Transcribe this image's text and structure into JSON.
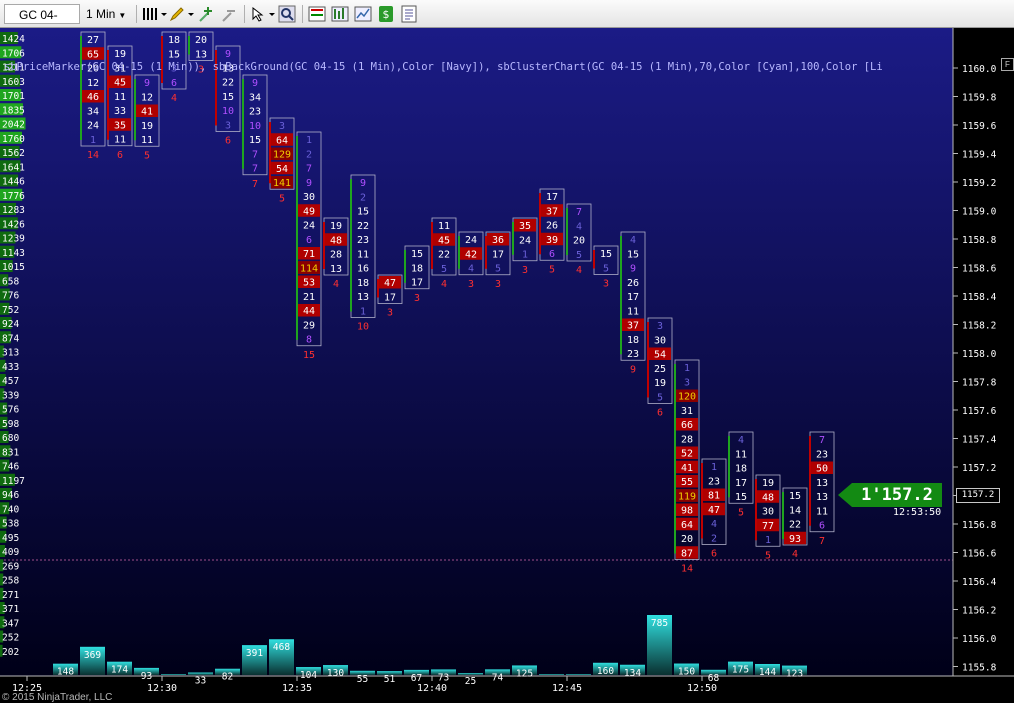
{
  "toolbar": {
    "instrument": "GC 04-15",
    "interval": "1 Min",
    "icons": [
      "bar-type-icon",
      "drawing-pencil-icon",
      "zoom-in-icon",
      "zoom-out-icon",
      "cursor-icon",
      "magnifier-icon",
      "chart-trader-icon",
      "indicators-icon",
      "strategies-icon",
      "order-icon",
      "properties-icon"
    ]
  },
  "chart": {
    "indicators_label": "sbPriceMarker(GC 04-15 (1 Min)), sbBackGround(GC 04-15 (1 Min),Color [Navy]), sbClusterChart(GC 04-15 (1 Min),70,Color [Cyan],100,Color [Li",
    "corner_button": "F",
    "last_price": "1'157.2",
    "axis_price_tag": "1157.2",
    "clock": "12:53:50",
    "copyright": "© 2015 NinjaTrader, LLC",
    "colors": {
      "background_top": "#1a1a7a",
      "background_bottom": "#000020",
      "ask_red": "#b00000",
      "bid_green": "#138a13",
      "volume_cyan": "#20d0d0",
      "text": "#ffffff",
      "purple_text": "#b050ff"
    },
    "price_axis": [
      "1160.0",
      "1159.8",
      "1159.6",
      "1159.4",
      "1159.2",
      "1159.0",
      "1158.8",
      "1158.6",
      "1158.4",
      "1158.2",
      "1158.0",
      "1157.8",
      "1157.6",
      "1157.4",
      "1157.2",
      "1157.0",
      "1156.8",
      "1156.6",
      "1156.4",
      "1156.2",
      "1156.0",
      "1155.8"
    ],
    "time_axis": [
      "12:25",
      "12:30",
      "12:35",
      "12:40",
      "12:45",
      "12:50"
    ],
    "left_volume_profile": [
      "1424",
      "1706",
      "1211",
      "1603",
      "1701",
      "1835",
      "2042",
      "1760",
      "1562",
      "1641",
      "1446",
      "1776",
      "1283",
      "1426",
      "1239",
      "1143",
      "1015",
      "658",
      "776",
      "752",
      "924",
      "874",
      "313",
      "433",
      "457",
      "339",
      "576",
      "598",
      "680",
      "831",
      "746",
      "1197",
      "946",
      "740",
      "538",
      "495",
      "409",
      "269",
      "258",
      "271",
      "371",
      "347",
      "252",
      "202"
    ],
    "columns": [
      {
        "top": [
          "27",
          "65",
          "20",
          "12",
          "46",
          "34",
          "24",
          "1"
        ],
        "bottom": "14"
      },
      {
        "top": [
          "19",
          "31",
          "45",
          "11",
          "33",
          "35",
          "11"
        ],
        "bottom": "6"
      },
      {
        "top": [
          "9",
          "12",
          "41",
          "19",
          "11"
        ],
        "bottom": "5"
      },
      {
        "top": [
          "18",
          "15",
          "3",
          "6"
        ],
        "bottom": "4"
      },
      {
        "top": [
          "20",
          "13"
        ],
        "bottom": "3"
      },
      {
        "top": [
          "9",
          "13",
          "22",
          "15",
          "10",
          "3"
        ],
        "bottom": "6"
      },
      {
        "top": [
          "9",
          "34",
          "23",
          "10",
          "15",
          "7",
          "7"
        ],
        "bottom": "7"
      },
      {
        "top": [
          "3",
          "64",
          "129",
          "54",
          "141"
        ],
        "bottom": "5"
      },
      {
        "top": [
          "1",
          "2",
          "7",
          "9",
          "30",
          "49",
          "24",
          "6",
          "71",
          "114",
          "53",
          "21",
          "44",
          "29",
          "8"
        ],
        "bottom": "15"
      },
      {
        "top": [
          "19",
          "48",
          "28",
          "13"
        ],
        "bottom": "4"
      },
      {
        "top": [
          "9",
          "2",
          "15",
          "22",
          "23",
          "11",
          "16",
          "18",
          "13",
          "1"
        ],
        "bottom": "10"
      },
      {
        "top": [
          "47",
          "17"
        ],
        "bottom": "3"
      },
      {
        "top": [
          "15",
          "18",
          "17"
        ],
        "bottom": "3"
      },
      {
        "top": [
          "11",
          "45",
          "22",
          "5"
        ],
        "bottom": "4"
      },
      {
        "top": [
          "24",
          "42",
          "4"
        ],
        "bottom": "3"
      },
      {
        "top": [
          "36",
          "17",
          "5"
        ],
        "bottom": "3"
      },
      {
        "top": [
          "35",
          "24",
          "1"
        ],
        "bottom": "3"
      },
      {
        "top": [
          "17",
          "37",
          "26",
          "39",
          "6"
        ],
        "bottom": "5"
      },
      {
        "top": [
          "7",
          "4",
          "20",
          "5"
        ],
        "bottom": "4"
      },
      {
        "top": [
          "15",
          "5"
        ],
        "bottom": "3"
      },
      {
        "top": [
          "4",
          "15",
          "9",
          "26",
          "17",
          "11",
          "37",
          "18",
          "23"
        ],
        "bottom": "9"
      },
      {
        "top": [
          "3",
          "30",
          "54",
          "25",
          "19",
          "5"
        ],
        "bottom": "6"
      },
      {
        "top": [
          "1",
          "3",
          "120",
          "31",
          "66",
          "28",
          "52",
          "41",
          "55",
          "119",
          "98",
          "64",
          "20",
          "87"
        ],
        "bottom": "14"
      },
      {
        "top": [
          "1",
          "23",
          "81",
          "47",
          "4",
          "2"
        ],
        "bottom": "6"
      },
      {
        "top": [
          "4",
          "11",
          "18",
          "17",
          "15"
        ],
        "bottom": "5"
      },
      {
        "top": [
          "19",
          "48",
          "30",
          "77",
          "1"
        ],
        "bottom": "5"
      },
      {
        "top": [
          "15",
          "14",
          "22",
          "93"
        ],
        "bottom": "4"
      },
      {
        "top": [
          "7",
          "23",
          "50",
          "13",
          "13",
          "11",
          "6"
        ],
        "bottom": "7"
      }
    ],
    "volume_bars": [
      {
        "label": "148"
      },
      {
        "label": "369"
      },
      {
        "label": "174"
      },
      {
        "label": "93"
      },
      {
        "label": ""
      },
      {
        "label": "33"
      },
      {
        "label": "82"
      },
      {
        "label": "391"
      },
      {
        "label": "468"
      },
      {
        "label": "104"
      },
      {
        "label": "130"
      },
      {
        "label": "55"
      },
      {
        "label": "51"
      },
      {
        "label": "67"
      },
      {
        "label": "73"
      },
      {
        "label": "25"
      },
      {
        "label": "74"
      },
      {
        "label": "125"
      },
      {
        "label": ""
      },
      {
        "label": ""
      },
      {
        "label": "160"
      },
      {
        "label": "134"
      },
      {
        "label": "785"
      },
      {
        "label": "150"
      },
      {
        "label": "68"
      },
      {
        "label": "175"
      },
      {
        "label": "144"
      },
      {
        "label": "123"
      }
    ]
  }
}
